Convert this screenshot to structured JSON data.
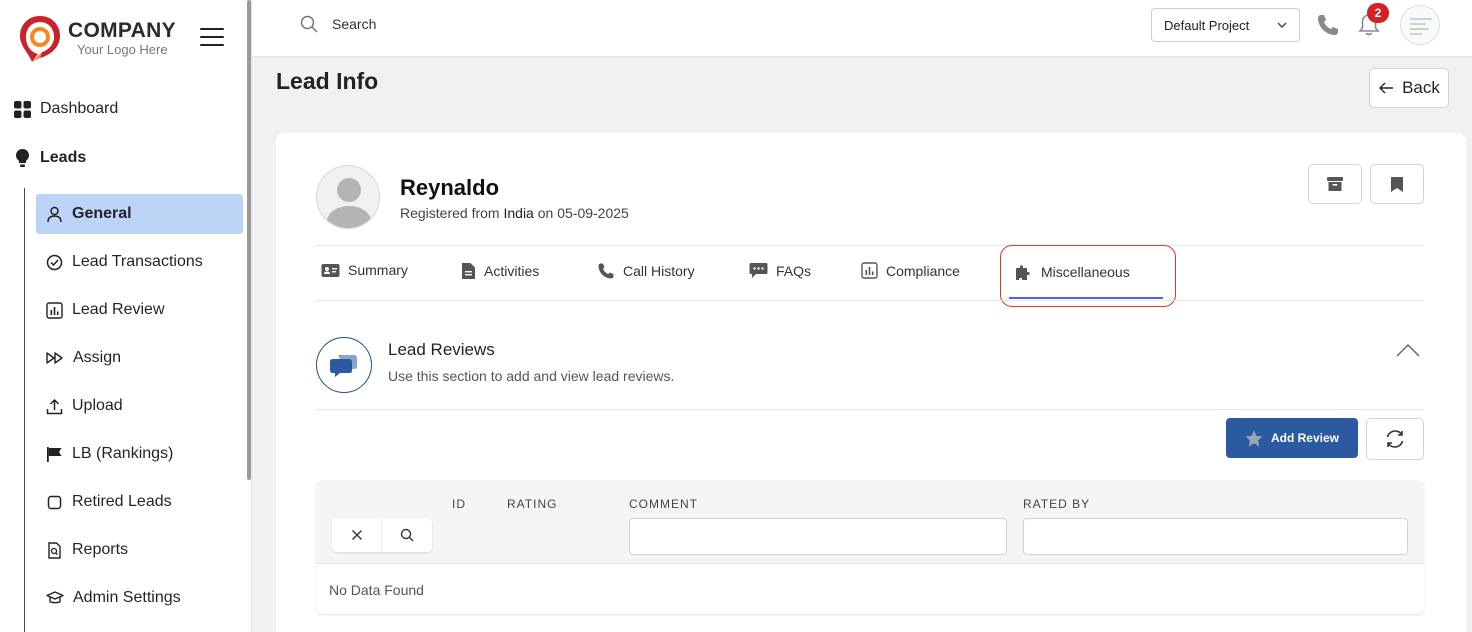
{
  "brand": {
    "title": "COMPANY",
    "subtitle": "Your Logo Here"
  },
  "sidebar": {
    "top": [
      {
        "label": "Dashboard",
        "icon": "grid-icon"
      },
      {
        "label": "Leads",
        "icon": "lightbulb-icon"
      }
    ],
    "items": [
      {
        "label": "General",
        "icon": "user-icon",
        "active": true
      },
      {
        "label": "Lead Transactions",
        "icon": "check-circle-icon"
      },
      {
        "label": "Lead Review",
        "icon": "bar-chart-icon"
      },
      {
        "label": "Assign",
        "icon": "fast-forward-icon"
      },
      {
        "label": "Upload",
        "icon": "upload-icon"
      },
      {
        "label": "LB (Rankings)",
        "icon": "flag-icon"
      },
      {
        "label": "Retired Leads",
        "icon": "square-icon"
      },
      {
        "label": "Reports",
        "icon": "file-search-icon"
      },
      {
        "label": "Admin Settings",
        "icon": "graduation-cap-icon"
      }
    ]
  },
  "topbar": {
    "search_placeholder": "Search",
    "project": "Default Project",
    "notifications": "2"
  },
  "page": {
    "title": "Lead Info",
    "back_label": "Back"
  },
  "profile": {
    "name": "Reynaldo",
    "registered_prefix": "Registered from",
    "country": "India",
    "date_prefix": "on",
    "date": "05-09-2025"
  },
  "tabs": [
    {
      "label": "Summary",
      "icon": "id-card-icon"
    },
    {
      "label": "Activities",
      "icon": "file-text-icon"
    },
    {
      "label": "Call History",
      "icon": "phone-icon"
    },
    {
      "label": "FAQs",
      "icon": "chat-icon"
    },
    {
      "label": "Compliance",
      "icon": "bar-chart-icon"
    },
    {
      "label": "Miscellaneous",
      "icon": "puzzle-icon",
      "active": true
    }
  ],
  "reviews": {
    "title": "Lead Reviews",
    "subtitle": "Use this section to add and view lead reviews.",
    "add_label": "Add Review",
    "columns": [
      "ID",
      "RATING",
      "COMMENT",
      "RATED BY"
    ],
    "empty": "No Data Found"
  },
  "colors": {
    "primary": "#2b5aa0",
    "active_nav": "#bcd5f7",
    "highlight": "#d93a2b",
    "tab_underline": "#4d63d6",
    "badge": "#d32222"
  }
}
